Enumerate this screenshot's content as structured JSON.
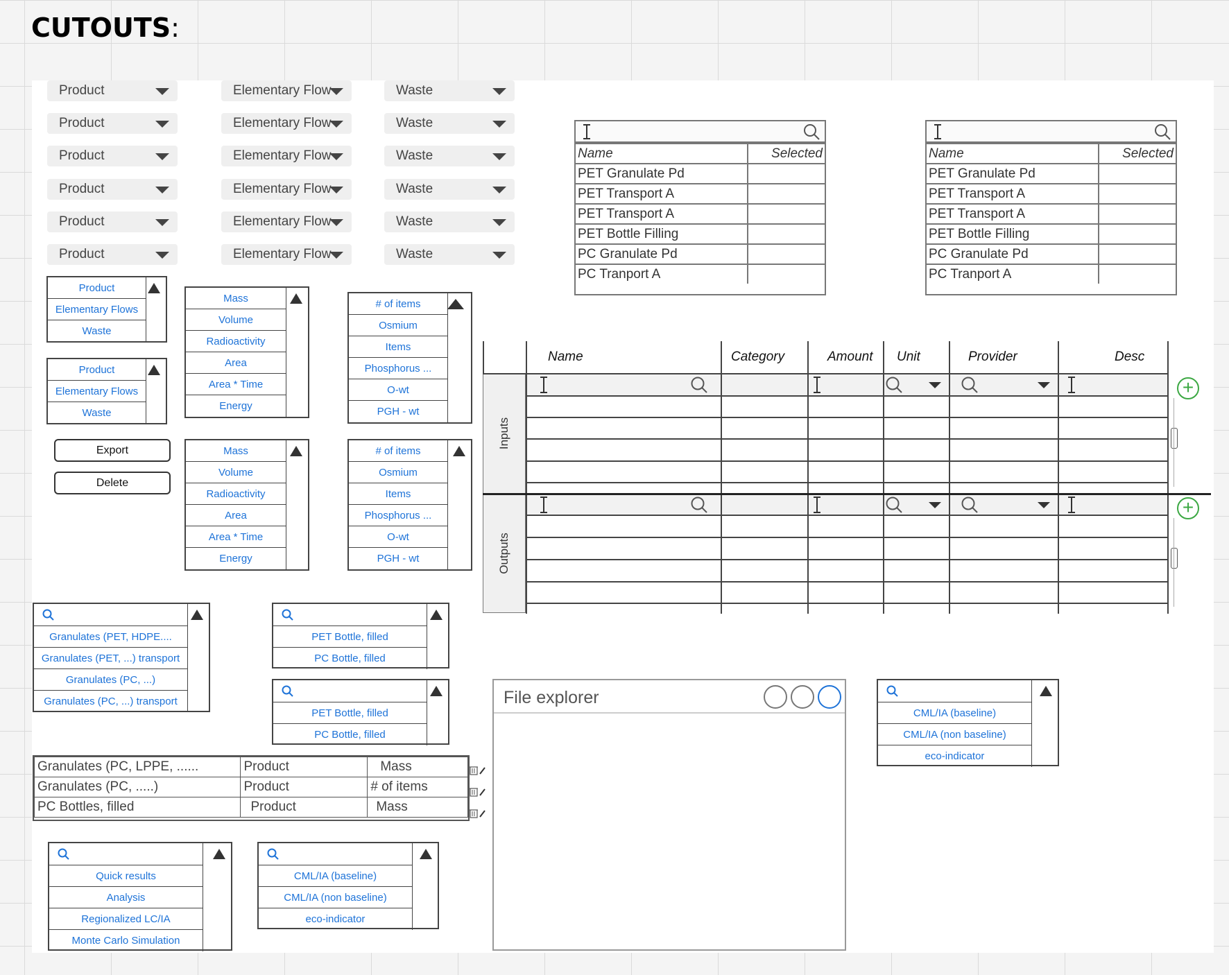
{
  "title": {
    "text": "CUTOUTS",
    "colon": ":"
  },
  "dropdowns": {
    "col1": "Product",
    "col2": "Elementary Flow",
    "col3": "Waste"
  },
  "type_list": [
    "Product",
    "Elementary Flows",
    "Waste"
  ],
  "unit_list_a": [
    "Mass",
    "Volume",
    "Radioactivity",
    "Area",
    "Area * Time",
    "Energy"
  ],
  "unit_list_b": [
    "# of items",
    "Osmium",
    "Items",
    "Phosphorus ...",
    "O-wt",
    "PGH - wt"
  ],
  "buttons": {
    "export": "Export",
    "delete": "Delete"
  },
  "selection_table": {
    "headers": [
      "Name",
      "Selected"
    ],
    "rows": [
      "PET Granulate Pd",
      "PET Transport A",
      "PET Transport A",
      "PET Bottle Filling",
      "PC Granulate Pd",
      "PC Tranport A"
    ]
  },
  "io": {
    "headers": [
      "Name",
      "Category",
      "Amount",
      "Unit",
      "Provider",
      "Desc"
    ],
    "inputs_label": "Inputs",
    "outputs_label": "Outputs"
  },
  "granulates_list": [
    "Granulates (PET, HDPE....",
    "Granulates (PET, ...) transport",
    "Granulates (PC, ...)",
    "Granulates (PC, ...) transport"
  ],
  "bottles_list": [
    "PET Bottle, filled",
    "PC Bottle, filled"
  ],
  "result_rows": [
    [
      "Granulates (PC, LPPE,  ......",
      "Product",
      "Mass"
    ],
    [
      "Granulates (PC, .....)",
      "Product",
      "# of items"
    ],
    [
      "PC Bottles, filled",
      "Product",
      "Mass"
    ]
  ],
  "analysis_list": [
    "Quick results",
    "Analysis",
    "Regionalized LC/IA",
    "Monte Carlo Simulation"
  ],
  "method_list": [
    "CML/IA (baseline)",
    "CML/IA (non baseline)",
    "eco-indicator"
  ],
  "file_explorer": {
    "title": "File explorer"
  },
  "colors": {
    "link_blue": "#1e73d8",
    "add_green": "#3ca843"
  }
}
